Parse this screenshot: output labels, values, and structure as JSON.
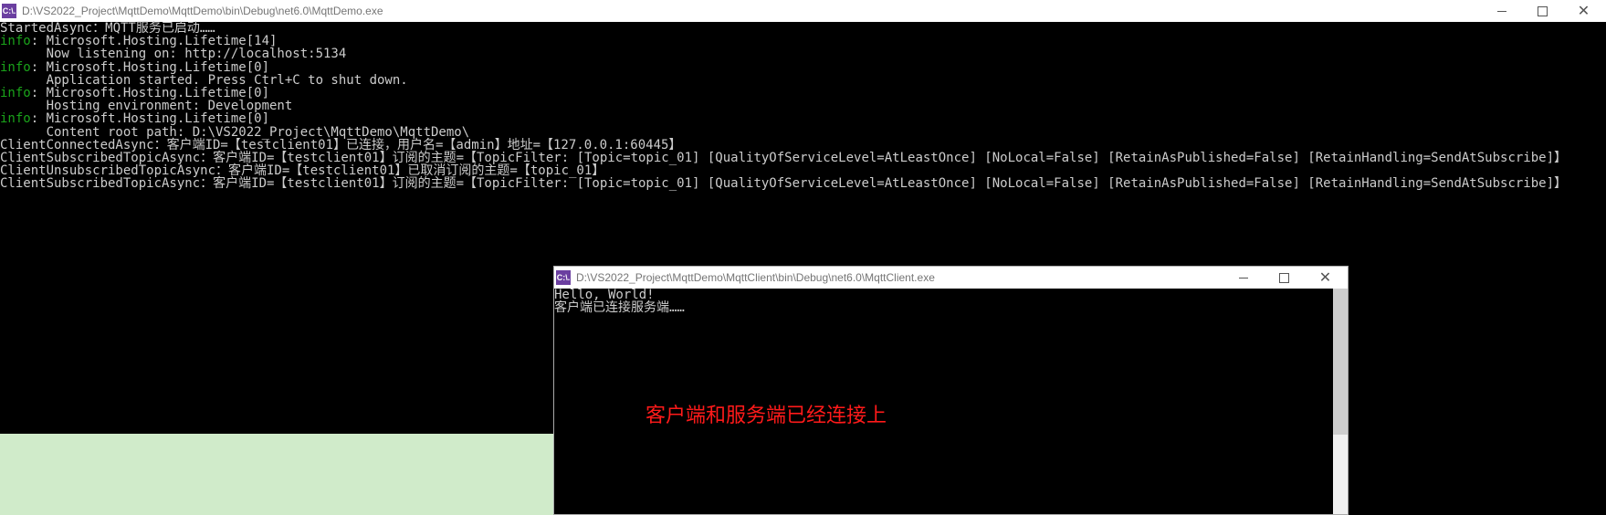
{
  "mainWindow": {
    "iconText": "C:\\.",
    "title": "D:\\VS2022_Project\\MqttDemo\\MqttDemo\\bin\\Debug\\net6.0\\MqttDemo.exe",
    "lines": {
      "l0_plain": "StartedAsync：MQTT服务已启动……",
      "l1_info": "info",
      "l1_rest": ": Microsoft.Hosting.Lifetime[14]",
      "l2": "      Now listening on: http://localhost:5134",
      "l3_info": "info",
      "l3_rest": ": Microsoft.Hosting.Lifetime[0]",
      "l4": "      Application started. Press Ctrl+C to shut down.",
      "l5_info": "info",
      "l5_rest": ": Microsoft.Hosting.Lifetime[0]",
      "l6": "      Hosting environment: Development",
      "l7_info": "info",
      "l7_rest": ": Microsoft.Hosting.Lifetime[0]",
      "l8": "      Content root path: D:\\VS2022_Project\\MqttDemo\\MqttDemo\\",
      "l9": "ClientConnectedAsync：客户端ID=【testclient01】已连接，用户名=【admin】地址=【127.0.0.1:60445】",
      "l10": "ClientSubscribedTopicAsync：客户端ID=【testclient01】订阅的主题=【TopicFilter: [Topic=topic_01] [QualityOfServiceLevel=AtLeastOnce] [NoLocal=False] [RetainAsPublished=False] [RetainHandling=SendAtSubscribe]】",
      "l11": "ClientUnsubscribedTopicAsync：客户端ID=【testclient01】已取消订阅的主题=【topic_01】",
      "l12": "ClientSubscribedTopicAsync：客户端ID=【testclient01】订阅的主题=【TopicFilter: [Topic=topic_01] [QualityOfServiceLevel=AtLeastOnce] [NoLocal=False] [RetainAsPublished=False] [RetainHandling=SendAtSubscribe]】"
    }
  },
  "clientWindow": {
    "iconText": "C:\\.",
    "title": "D:\\VS2022_Project\\MqttDemo\\MqttClient\\bin\\Debug\\net6.0\\MqttClient.exe",
    "lines": {
      "c0": "Hello, World!",
      "c1": "客户端已连接服务端……"
    }
  },
  "annotation": "客户端和服务端已经连接上",
  "btn": {
    "close": "✕"
  }
}
